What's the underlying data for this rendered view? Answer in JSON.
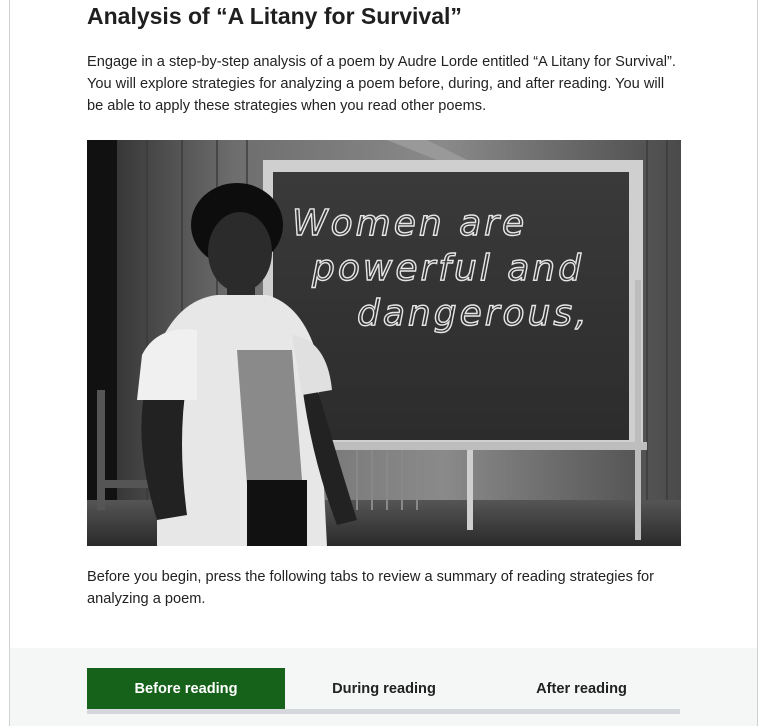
{
  "page": {
    "title": "Analysis of “A Litany for Survival”",
    "intro": "Engage in a step-by-step analysis of a poem by Audre Lorde entitled “A Litany for Survival”. You will explore strategies for analyzing a poem before, during, and after reading. You will be able to apply these strategies when you read other poems.",
    "instructions": "Before you begin, press the following tabs to review a summary of reading strategies for analyzing a poem."
  },
  "hero": {
    "chalk_lines": [
      "Women are",
      "powerful and",
      "dangerous,"
    ]
  },
  "tabs": [
    {
      "label": "Before reading",
      "active": true
    },
    {
      "label": "During reading",
      "active": false
    },
    {
      "label": "After reading",
      "active": false
    }
  ],
  "colors": {
    "active_tab": "#17621a",
    "tab_band": "#f5f6f6",
    "tab_underline": "#d4d8dc"
  }
}
